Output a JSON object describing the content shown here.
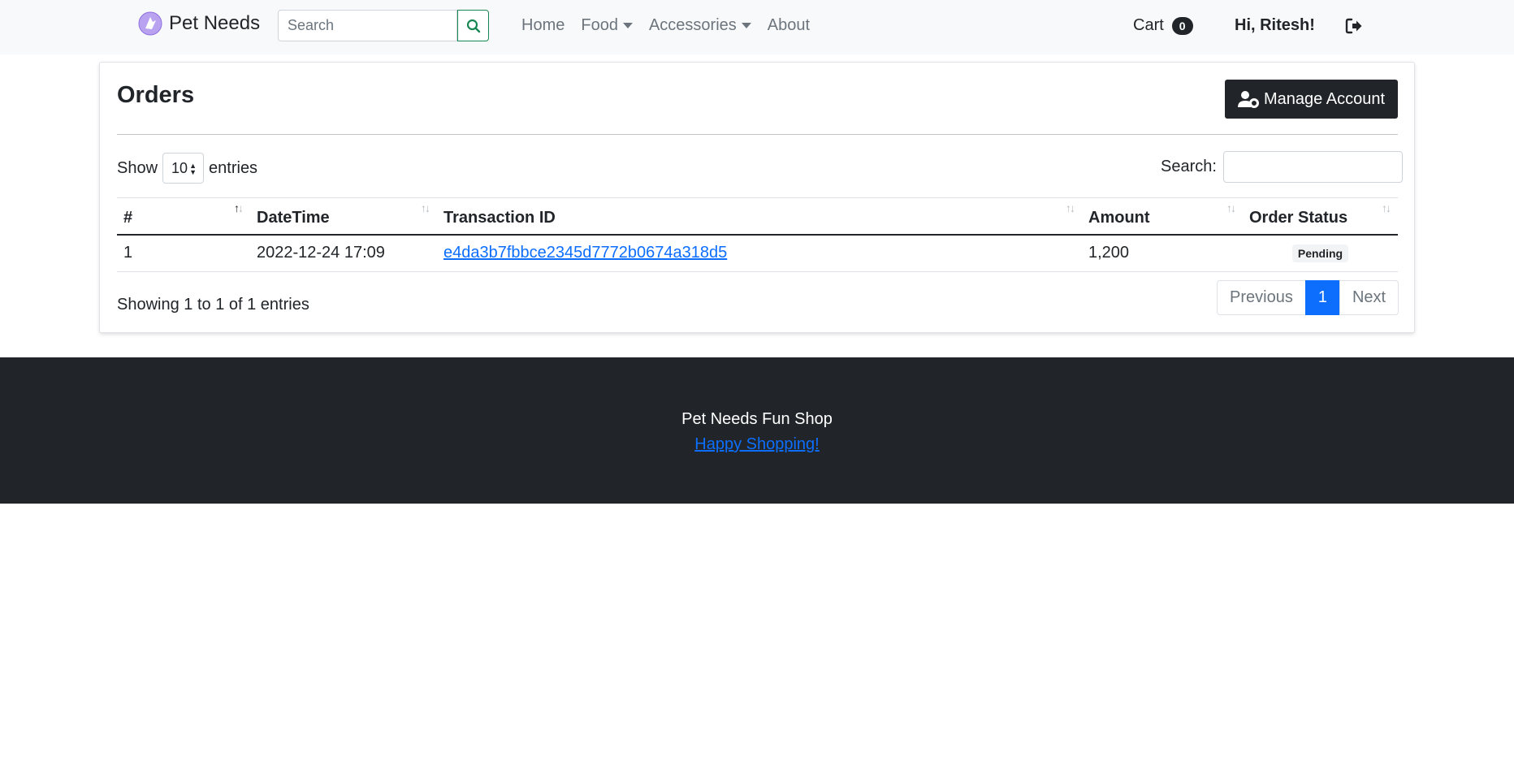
{
  "navbar": {
    "brand": "Pet Needs",
    "search_placeholder": "Search",
    "links": [
      {
        "label": "Home"
      },
      {
        "label": "Food"
      },
      {
        "label": "Accessories"
      },
      {
        "label": "About"
      }
    ],
    "cart_label": "Cart",
    "cart_count": "0",
    "greeting": "Hi, Ritesh!"
  },
  "card": {
    "title": "Orders",
    "manage_button": "Manage Account"
  },
  "datatable": {
    "show_label": "Show",
    "entries_label": "entries",
    "length_value": "10",
    "search_label": "Search:",
    "columns": [
      "#",
      "DateTime",
      "Transaction ID",
      "Amount",
      "Order Status"
    ],
    "rows": [
      {
        "index": "1",
        "datetime": "2022-12-24 17:09",
        "transaction_id": "e4da3b7fbbce2345d7772b0674a318d5",
        "amount": "1,200",
        "status": "Pending"
      }
    ],
    "info": "Showing 1 to 1 of 1 entries",
    "pagination": {
      "previous": "Previous",
      "current": "1",
      "next": "Next"
    }
  },
  "footer": {
    "title": "Pet Needs Fun Shop",
    "link": "Happy Shopping!"
  },
  "colors": {
    "primary": "#0d6efd",
    "dark": "#212529",
    "success": "#198754",
    "navbar_bg": "#f8f9fa"
  }
}
